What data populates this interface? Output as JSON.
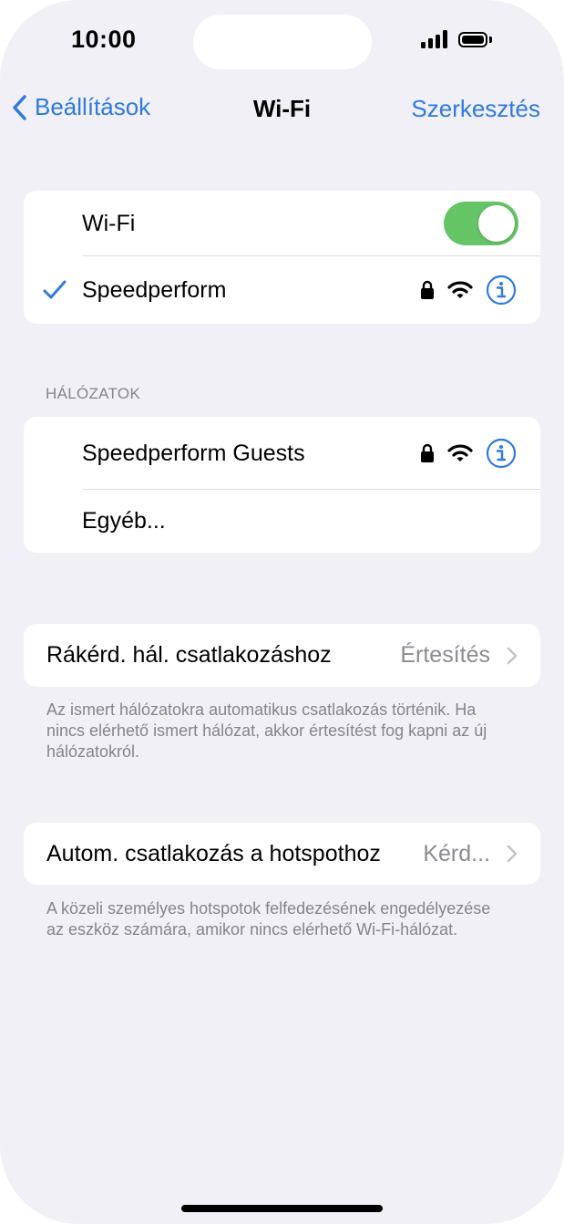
{
  "status_bar": {
    "time": "10:00"
  },
  "nav": {
    "back_label": "Beállítások",
    "title": "Wi-Fi",
    "edit_label": "Szerkesztés"
  },
  "wifi_card": {
    "toggle_label": "Wi-Fi",
    "toggle_on": true,
    "connected_network": "Speedperform"
  },
  "networks": {
    "header": "HÁLÓZATOK",
    "items": [
      {
        "label": "Speedperform Guests"
      },
      {
        "label": "Egyéb..."
      }
    ]
  },
  "ask_to_join": {
    "label": "Rákérd. hál. csatlakozáshoz",
    "value": "Értesítés",
    "footnote": "Az ismert hálózatokra automatikus csatlakozás történik. Ha nincs elérhető ismert hálózat, akkor értesítést fog kapni az új hálózatokról."
  },
  "auto_hotspot": {
    "label": "Autom. csatlakozás a hotspothoz",
    "value": "Kérd...",
    "footnote": "A közeli személyes hotspotok felfedezésének engedélyezése az eszköz számára, amikor nincs elérhető Wi-Fi-hálózat."
  },
  "colors": {
    "accent": "#2f7ae0",
    "toggle_on": "#64c466",
    "background": "#f1f0f6",
    "secondary_text": "#85848a"
  },
  "icons": {
    "back": "chevron-left-icon",
    "check": "checkmark-icon",
    "lock": "lock-icon",
    "wifi": "wifi-icon",
    "info": "info-icon",
    "chevron": "chevron-right-icon"
  }
}
